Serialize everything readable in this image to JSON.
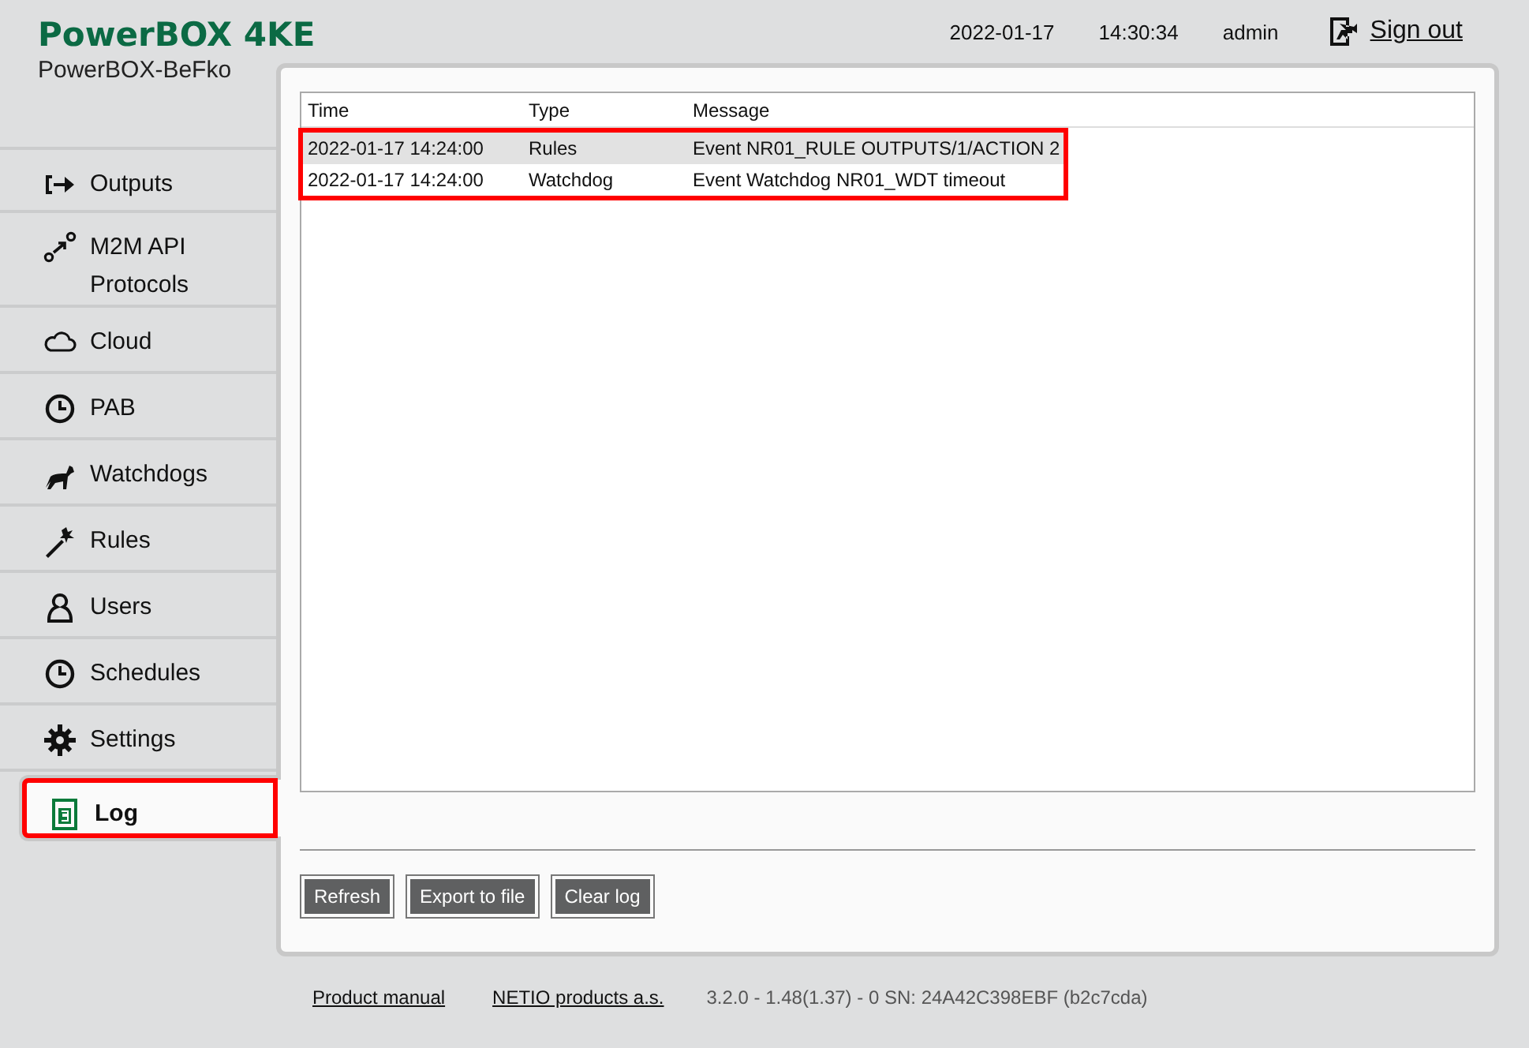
{
  "header": {
    "title": "PowerBOX 4KE",
    "subtitle": "PowerBOX-BeFko",
    "date": "2022-01-17",
    "time": "14:30:34",
    "user": "admin",
    "sign_out": "Sign out"
  },
  "nav": [
    {
      "label": "Outputs",
      "kind": "outputs",
      "selected": false,
      "highlighted": false
    },
    {
      "label": "M2M API Protocols",
      "kind": "m2m",
      "selected": false,
      "highlighted": false
    },
    {
      "label": "Cloud",
      "kind": "cloud",
      "selected": false,
      "highlighted": false
    },
    {
      "label": "PAB",
      "kind": "clock",
      "selected": false,
      "highlighted": false
    },
    {
      "label": "Watchdogs",
      "kind": "dog",
      "selected": false,
      "highlighted": false
    },
    {
      "label": "Rules",
      "kind": "wand",
      "selected": false,
      "highlighted": false
    },
    {
      "label": "Users",
      "kind": "user",
      "selected": false,
      "highlighted": false
    },
    {
      "label": "Schedules",
      "kind": "clock",
      "selected": false,
      "highlighted": false
    },
    {
      "label": "Settings",
      "kind": "gear",
      "selected": false,
      "highlighted": false
    },
    {
      "label": "Log",
      "kind": "log",
      "selected": true,
      "highlighted": true
    }
  ],
  "log": {
    "columns": [
      "Time",
      "Type",
      "Message"
    ],
    "rows_highlighted": true,
    "rows": [
      {
        "time": "2022-01-17 14:24:00",
        "type": "Rules",
        "message": "Event NR01_RULE OUTPUTS/1/ACTION 2",
        "selected": true
      },
      {
        "time": "2022-01-17 14:24:00",
        "type": "Watchdog",
        "message": "Event Watchdog NR01_WDT timeout",
        "selected": false
      }
    ]
  },
  "buttons": [
    "Refresh",
    "Export to file",
    "Clear log"
  ],
  "footer": {
    "links": [
      "Product manual",
      "NETIO products a.s."
    ],
    "version": "3.2.0 - 1.48(1.37) - 0 SN: 24A42C398EBF (b2c7cda)"
  }
}
